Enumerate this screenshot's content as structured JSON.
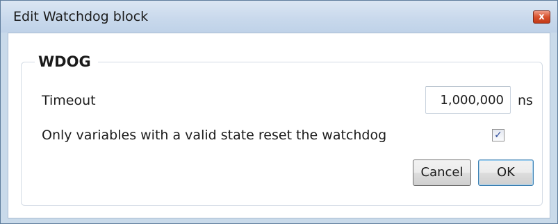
{
  "window": {
    "title": "Edit Watchdog block",
    "close_symbol": "x"
  },
  "group": {
    "title": "WDOG"
  },
  "timeout": {
    "label": "Timeout",
    "value": "1,000,000",
    "unit": "ns"
  },
  "valid_state": {
    "label": "Only variables with a valid state reset the watchdog",
    "checked": true,
    "check_mark": "✓"
  },
  "buttons": {
    "cancel": "Cancel",
    "ok": "OK"
  },
  "colors": {
    "titlebar": "#c9d9ec",
    "close_button": "#d8512e",
    "default_button_border": "#3c7fb1",
    "checkmark": "#2c4a9a"
  },
  "icons": {
    "close": "close-icon",
    "check": "checkmark-icon"
  }
}
